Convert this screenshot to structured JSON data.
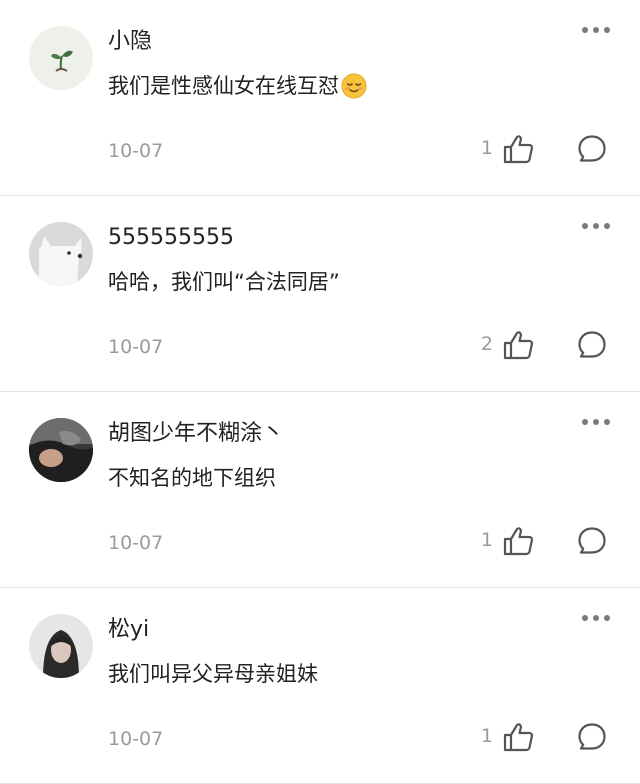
{
  "comments": [
    {
      "username": "小隐",
      "content": "我们是性感仙女在线互怼",
      "emoji": "relieved-face-emoji",
      "date": "10-07",
      "likes": "1",
      "avatar": "plant-sprout-avatar"
    },
    {
      "username": "555555555",
      "content": "哈哈，我们叫“合法同居”",
      "date": "10-07",
      "likes": "2",
      "avatar": "white-dog-avatar"
    },
    {
      "username": "胡图少年不糊涂丶",
      "content": "不知名的地下组织",
      "date": "10-07",
      "likes": "1",
      "avatar": "dark-photo-avatar"
    },
    {
      "username": "松yi",
      "content": "我们叫异父异母亲姐妹",
      "date": "10-07",
      "likes": "1",
      "avatar": "person-photo-avatar"
    }
  ],
  "colors": {
    "text": "#222222",
    "meta": "#9a9a9a",
    "divider": "#e3e3e3",
    "icon": "#555555"
  }
}
